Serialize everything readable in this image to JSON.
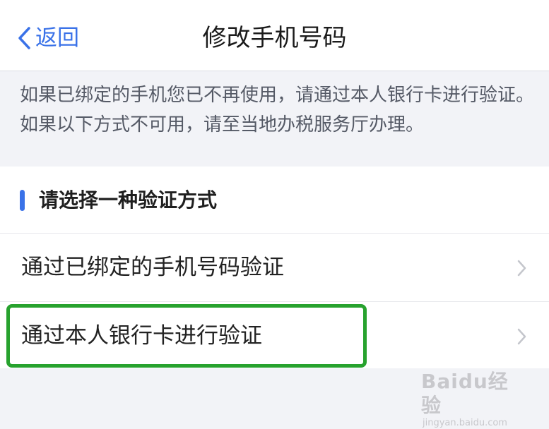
{
  "nav": {
    "back_label": "返回",
    "title": "修改手机号码"
  },
  "notice": {
    "text": "如果已绑定的手机您已不再使用，请通过本人银行卡进行验证。如果以下方式不可用，请至当地办税服务厅办理。"
  },
  "section": {
    "title": "请选择一种验证方式"
  },
  "options": [
    {
      "label": "通过已绑定的手机号码验证"
    },
    {
      "label": "通过本人银行卡进行验证"
    }
  ],
  "watermark": {
    "logo": "Baidu经验",
    "url": "jingyan.baidu.com"
  },
  "colors": {
    "accent": "#3a72e8",
    "highlight": "#27a22e",
    "background": "#f2f3f7"
  },
  "icons": {
    "back": "chevron-left-icon",
    "option_arrow": "chevron-right-icon"
  }
}
